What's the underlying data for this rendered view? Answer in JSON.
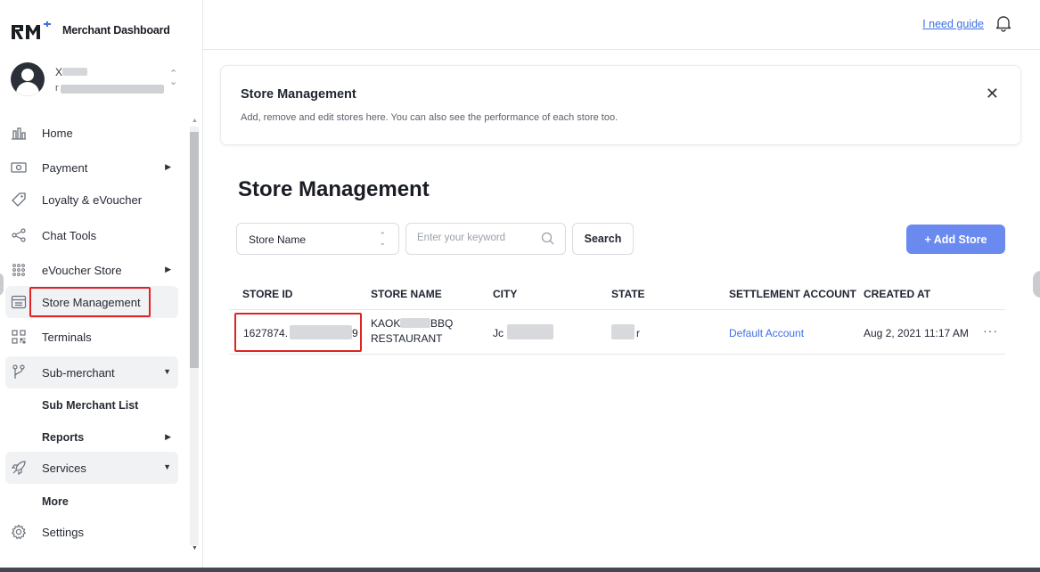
{
  "brand": {
    "logo_text": "RM",
    "title": "Merchant Dashboard"
  },
  "user": {
    "name_initial": "X",
    "sub_initial": "r"
  },
  "topbar": {
    "guide_link": "I need guide"
  },
  "sidebar": {
    "items": [
      {
        "label": "Home"
      },
      {
        "label": "Payment"
      },
      {
        "label": "Loyalty & eVoucher"
      },
      {
        "label": "Chat Tools"
      },
      {
        "label": "eVoucher Store"
      },
      {
        "label": "Store Management"
      },
      {
        "label": "Terminals"
      },
      {
        "label": "Sub-merchant"
      },
      {
        "label": "Sub Merchant List"
      },
      {
        "label": "Reports"
      },
      {
        "label": "Services"
      },
      {
        "label": "More"
      },
      {
        "label": "Settings"
      }
    ]
  },
  "info_card": {
    "title": "Store Management",
    "description": "Add, remove and edit stores here. You can also see the performance of each store too."
  },
  "page_title": "Store Management",
  "filters": {
    "select_value": "Store Name",
    "search_placeholder": "Enter your keyword",
    "search_button": "Search",
    "add_button": "+ Add Store"
  },
  "table": {
    "headers": [
      "STORE ID",
      "STORE NAME",
      "CITY",
      "STATE",
      "SETTLEMENT ACCOUNT",
      "CREATED AT"
    ],
    "rows": [
      {
        "store_id_start": "1627874.",
        "store_id_end": "9",
        "store_name_line1_start": "KAOK",
        "store_name_line1_end": "BBQ",
        "store_name_line2": "RESTAURANT",
        "city": "Jc",
        "state": "r",
        "settlement_account": "Default Account",
        "created_at": "Aug 2, 2021 11:17 AM",
        "more": "···"
      }
    ]
  },
  "colors": {
    "accent": "#3f6fe5",
    "add_button": "#6b8af0",
    "highlight": "#e02424"
  }
}
